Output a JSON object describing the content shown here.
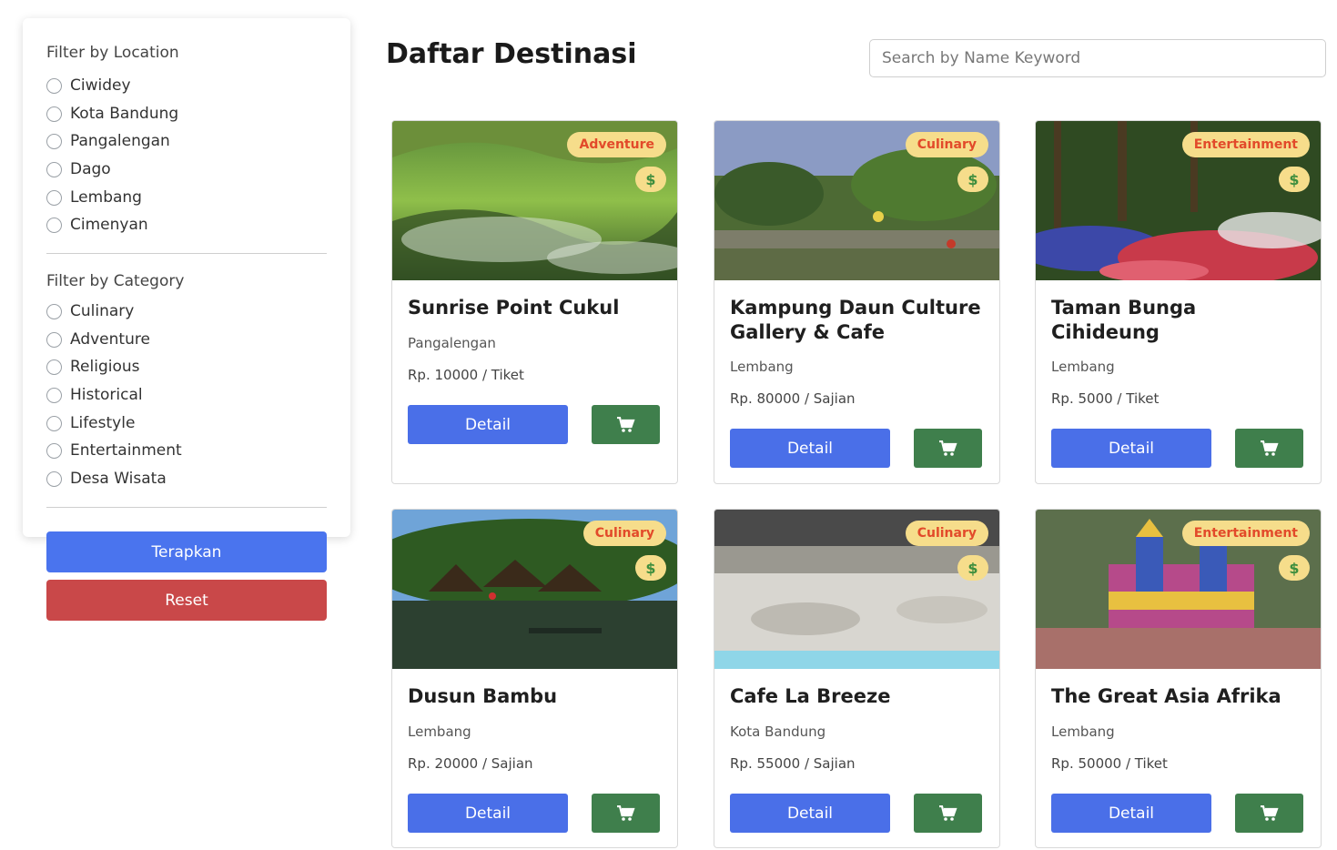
{
  "page": {
    "title": "Daftar Destinasi",
    "search_placeholder": "Search by Name Keyword"
  },
  "filters": {
    "location": {
      "title": "Filter by Location",
      "options": [
        "Ciwidey",
        "Kota Bandung",
        "Pangalengan",
        "Dago",
        "Lembang",
        "Cimenyan"
      ]
    },
    "category": {
      "title": "Filter by Category",
      "options": [
        "Culinary",
        "Adventure",
        "Religious",
        "Historical",
        "Lifestyle",
        "Entertainment",
        "Desa Wisata"
      ]
    },
    "apply_label": "Terapkan",
    "reset_label": "Reset"
  },
  "colors": {
    "primary": "#4a74ee",
    "danger": "#c94849",
    "success": "#3f7f4c",
    "badge_bg": "#f6dd8b",
    "badge_text": "#e24a2a"
  },
  "cards": [
    {
      "title": "Sunrise Point Cukul",
      "category": "Adventure",
      "price_badge": "$",
      "location": "Pangalengan",
      "price": "Rp. 10000 / Tiket",
      "detail_label": "Detail",
      "image": "mountain-landscape"
    },
    {
      "title": "Kampung Daun Culture Gallery & Cafe",
      "category": "Culinary",
      "price_badge": "$",
      "location": "Lembang",
      "price": "Rp. 80000 / Sajian",
      "detail_label": "Detail",
      "image": "garden-cafe"
    },
    {
      "title": "Taman Bunga Cihideung",
      "category": "Entertainment",
      "price_badge": "$",
      "location": "Lembang",
      "price": "Rp. 5000 / Tiket",
      "detail_label": "Detail",
      "image": "flower-garden"
    },
    {
      "title": "Dusun Bambu",
      "category": "Culinary",
      "price_badge": "$",
      "location": "Lembang",
      "price": "Rp. 20000 / Sajian",
      "detail_label": "Detail",
      "image": "lake-huts"
    },
    {
      "title": "Cafe La Breeze",
      "category": "Culinary",
      "price_badge": "$",
      "location": "Kota Bandung",
      "price": "Rp. 55000 / Sajian",
      "detail_label": "Detail",
      "image": "cafe-interior"
    },
    {
      "title": "The Great Asia Afrika",
      "category": "Entertainment",
      "price_badge": "$",
      "location": "Lembang",
      "price": "Rp. 50000 / Tiket",
      "detail_label": "Detail",
      "image": "colorful-buildings"
    }
  ]
}
